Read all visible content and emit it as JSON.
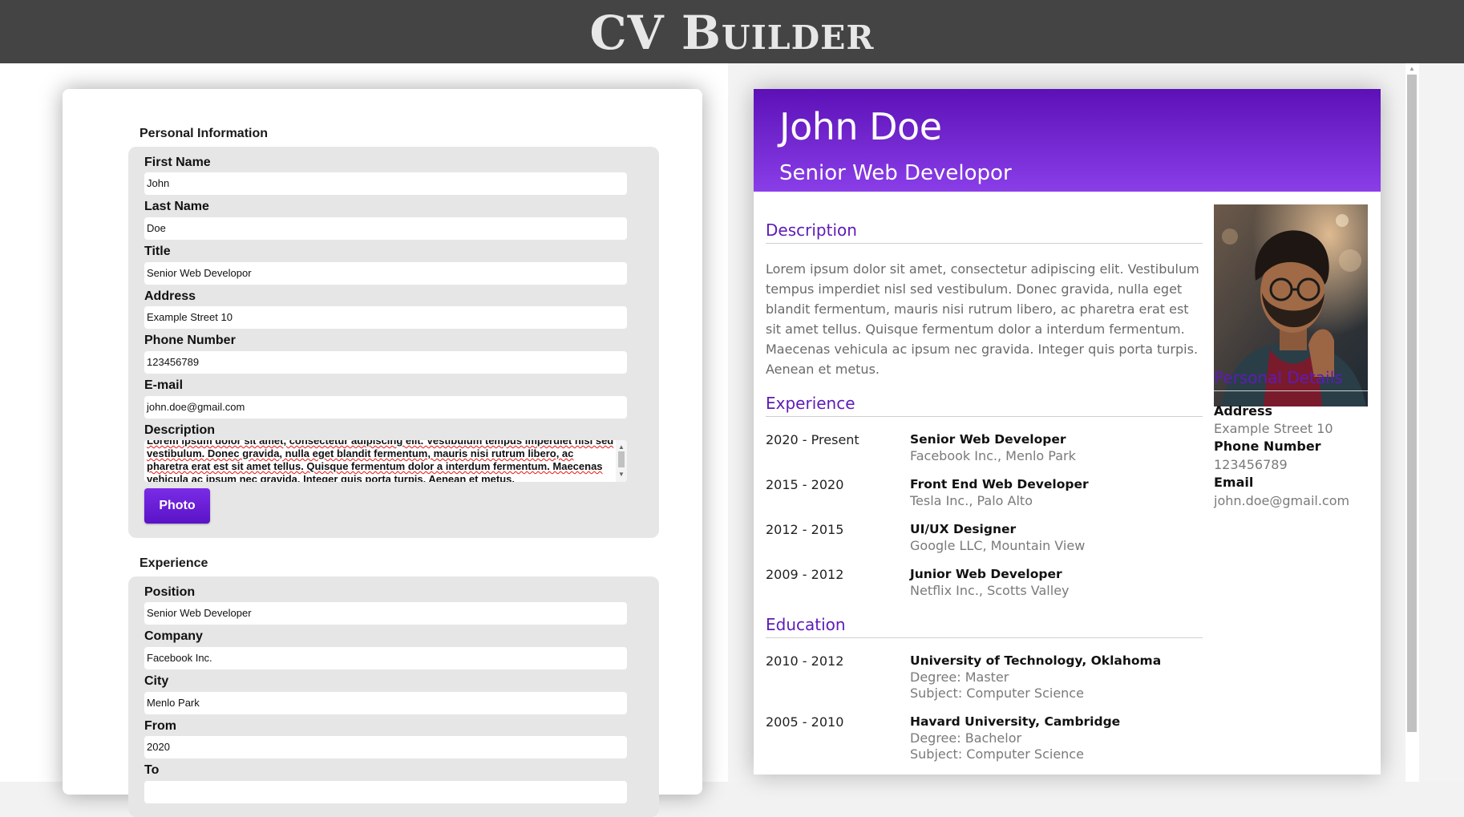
{
  "app": {
    "title": "CV Builder"
  },
  "form": {
    "personal": {
      "heading": "Personal Information",
      "first_name": {
        "label": "First Name",
        "value": "John"
      },
      "last_name": {
        "label": "Last Name",
        "value": "Doe"
      },
      "title": {
        "label": "Title",
        "value": "Senior Web Developor"
      },
      "address": {
        "label": "Address",
        "value": "Example Street 10"
      },
      "phone": {
        "label": "Phone Number",
        "value": "123456789"
      },
      "email": {
        "label": "E-mail",
        "value": "john.doe@gmail.com"
      },
      "description": {
        "label": "Description",
        "lines": [
          "Lorem ipsum dolor sit amet, consectetur adipiscing elit. Vestibulum tempus imperdiet nisl sed",
          "vestibulum. Donec gravida, nulla eget blandit fermentum, mauris nisi rutrum libero, ac",
          "pharetra erat est sit amet tellus. Quisque fermentum dolor a interdum fermentum. Maecenas",
          "vehicula ac ipsum nec gravida. Integer quis porta turpis. Aenean et metus."
        ]
      },
      "photo_button": "Photo"
    },
    "experience": {
      "heading": "Experience",
      "position": {
        "label": "Position",
        "value": "Senior Web Developer"
      },
      "company": {
        "label": "Company",
        "value": "Facebook Inc."
      },
      "city": {
        "label": "City",
        "value": "Menlo Park"
      },
      "from": {
        "label": "From",
        "value": "2020"
      },
      "to": {
        "label": "To",
        "value": ""
      }
    }
  },
  "cv": {
    "name": "John Doe",
    "title": "Senior Web Developor",
    "description_heading": "Description",
    "description": "Lorem ipsum dolor sit amet, consectetur adipiscing elit. Vestibulum tempus imperdiet nisl sed vestibulum. Donec gravida, nulla eget blandit fermentum, mauris nisi rutrum libero, ac pharetra erat est sit amet tellus. Quisque fermentum dolor a interdum fermentum. Maecenas vehicula ac ipsum nec gravida. Integer quis porta turpis. Aenean et metus.",
    "experience_heading": "Experience",
    "experience": [
      {
        "period": "2020 - Present",
        "role": "Senior Web Developer",
        "detail": "Facebook Inc., Menlo Park"
      },
      {
        "period": "2015 - 2020",
        "role": "Front End Web Developer",
        "detail": "Tesla Inc., Palo Alto"
      },
      {
        "period": "2012 - 2015",
        "role": "UI/UX Designer",
        "detail": "Google LLC, Mountain View"
      },
      {
        "period": "2009 - 2012",
        "role": "Junior Web Developer",
        "detail": "Netflix Inc., Scotts Valley"
      }
    ],
    "education_heading": "Education",
    "education": [
      {
        "period": "2010 - 2012",
        "school": "University of Technology, Oklahoma",
        "degree": "Degree: Master",
        "subject": "Subject: Computer Science"
      },
      {
        "period": "2005 - 2010",
        "school": "Havard University, Cambridge",
        "degree": "Degree: Bachelor",
        "subject": "Subject: Computer Science"
      }
    ],
    "personal_heading": "Personal Details",
    "personal": {
      "address_label": "Address",
      "address": "Example Street 10",
      "phone_label": "Phone Number",
      "phone": "123456789",
      "email_label": "Email",
      "email": "john.doe@gmail.com"
    }
  },
  "colors": {
    "accent": "#5e1bb8",
    "header_bar": "#444444",
    "field_group": "#e6e6e6"
  }
}
